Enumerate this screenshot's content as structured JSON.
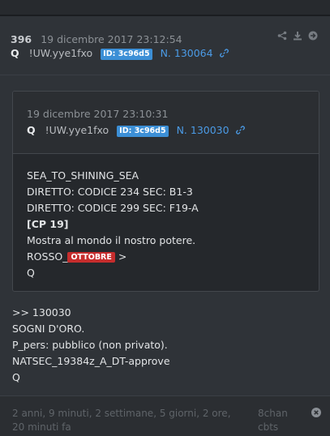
{
  "post": {
    "number": "396",
    "date": "19 dicembre 2017 23:12:54",
    "name": "Q",
    "tripcode": "!UW.yye1fxo",
    "id_badge": "ID: 3c96d5",
    "link": "N. 130064"
  },
  "quoted": {
    "date": "19 dicembre 2017 23:10:31",
    "name": "Q",
    "tripcode": "!UW.yye1fxo",
    "id_badge": "ID: 3c96d5",
    "link": "N. 130030",
    "lines": [
      "SEA_TO_SHINING_SEA",
      "DIRETTO: CODICE 234 SEC: B1-3",
      "DIRETTO: CODICE 299 SEC: F19-A",
      "[CP 19]",
      "Mostra al mondo il nostro potere."
    ],
    "rosso_prefix": "ROSSO_",
    "rosso_badge": "OTTOBRE",
    "rosso_suffix": " >",
    "signature": "Q"
  },
  "body": {
    "lines": [
      ">> 130030",
      "SOGNI D'ORO.",
      "P_pers: pubblico (non privato).",
      "NATSEC_19384z_A_DT-approve",
      "Q"
    ]
  },
  "footer": {
    "relative_time": "2 anni, 9 minuti, 2 settimane, 5 giorni, 2 ore, 20 minuti fa",
    "source_line1": "8chan",
    "source_line2": "cbts"
  },
  "icons": [
    "share-icon",
    "download-icon",
    "arrow-right-circle-icon",
    "link-icon",
    "close-icon"
  ],
  "colors": {
    "background": "#2f3338",
    "link": "#4b9be6",
    "id_badge": "#3c8fd6",
    "red_badge": "#c62d2d"
  }
}
